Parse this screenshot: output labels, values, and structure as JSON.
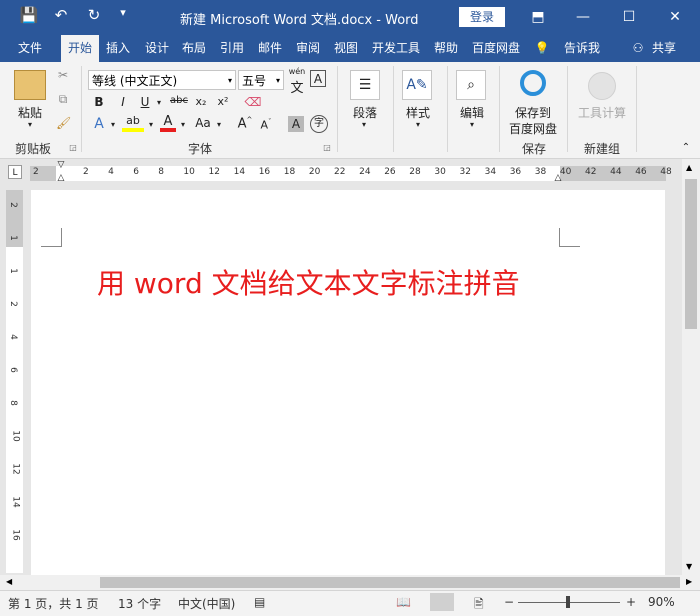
{
  "titlebar": {
    "doc_title": "新建 Microsoft Word 文档.docx  -  Word",
    "login": "登录",
    "quick_save": "💾",
    "quick_undo": "↶",
    "quick_redo": "↻",
    "quick_more": "▾"
  },
  "tabs": [
    "文件",
    "开始",
    "插入",
    "设计",
    "布局",
    "引用",
    "邮件",
    "审阅",
    "视图",
    "开发工具",
    "帮助",
    "百度网盘"
  ],
  "tell_me": "告诉我",
  "share": "共享",
  "ribbon": {
    "clipboard": {
      "paste": "粘贴",
      "label": "剪贴板"
    },
    "font": {
      "font_name": "等线 (中文正文)",
      "font_size": "五号",
      "label": "字体",
      "phonetic_top": "wén",
      "phonetic_char": "文",
      "border_char": "A"
    },
    "paragraph": {
      "label": "段落"
    },
    "styles": {
      "label": "样式"
    },
    "editing": {
      "label": "编辑"
    },
    "save": {
      "label_line1": "保存到",
      "label_line2": "百度网盘",
      "group": "保存"
    },
    "new_group": {
      "tool": "工具计算",
      "group": "新建组"
    },
    "format_buttons": [
      "B",
      "I",
      "U",
      "abc",
      "x₂",
      "x²"
    ]
  },
  "ruler": {
    "h_left_marker": "2",
    "h_numbers": [
      "2",
      "4",
      "6",
      "8",
      "10",
      "12",
      "14",
      "16",
      "18",
      "20",
      "22",
      "24",
      "26",
      "28",
      "30",
      "32",
      "34",
      "36",
      "38",
      "40",
      "42",
      "44",
      "46",
      "48"
    ],
    "v_numbers": [
      "2",
      "1",
      "1",
      "2",
      "4",
      "6",
      "8",
      "10",
      "12",
      "14",
      "16"
    ]
  },
  "document": {
    "text": "用 word 文档给文本文字标注拼音"
  },
  "status": {
    "page": "第 1 页，共 1 页",
    "words": "13 个字",
    "lang": "中文(中国)",
    "zoom": "90%"
  },
  "colors": {
    "title_blue": "#2b579a",
    "doc_red": "#e81e1e"
  }
}
